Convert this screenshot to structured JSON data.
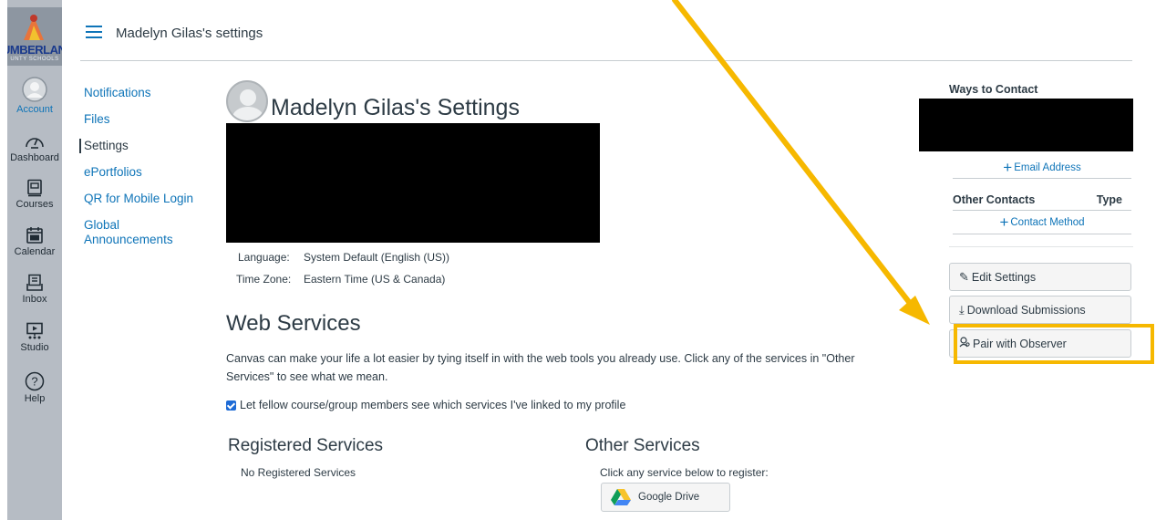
{
  "global_nav": {
    "logo": {
      "brand": "UMBERLAND",
      "sub": "UNTY SCHOOLS"
    },
    "items": [
      {
        "label": "Account",
        "icon": "account-icon"
      },
      {
        "label": "Dashboard",
        "icon": "dashboard-icon"
      },
      {
        "label": "Courses",
        "icon": "courses-icon"
      },
      {
        "label": "Calendar",
        "icon": "calendar-icon"
      },
      {
        "label": "Inbox",
        "icon": "inbox-icon"
      },
      {
        "label": "Studio",
        "icon": "studio-icon"
      },
      {
        "label": "Help",
        "icon": "help-icon"
      }
    ]
  },
  "header": {
    "breadcrumb": "Madelyn Gilas's settings"
  },
  "left_menu": {
    "items": [
      {
        "label": "Notifications",
        "active": false
      },
      {
        "label": "Files",
        "active": false
      },
      {
        "label": "Settings",
        "active": true
      },
      {
        "label": "ePortfolios",
        "active": false
      },
      {
        "label": "QR for Mobile Login",
        "active": false
      },
      {
        "label": "Global Announcements",
        "active": false
      }
    ]
  },
  "main": {
    "title": "Madelyn Gilas's Settings",
    "language_label": "Language:",
    "language_value": "System Default (English (US))",
    "timezone_label": "Time Zone:",
    "timezone_value": "Eastern Time (US & Canada)",
    "web_services_title": "Web Services",
    "web_services_desc": "Canvas can make your life a lot easier by tying itself in with the web tools you already use. Click any of the services in \"Other Services\" to see what we mean.",
    "checkbox_label": "Let fellow course/group members see which services I've linked to my profile",
    "checkbox_checked": true,
    "registered_title": "Registered Services",
    "registered_empty": "No Registered Services",
    "other_title": "Other Services",
    "other_hint": "Click any service below to register:",
    "google_drive_label": "Google Drive"
  },
  "sidebar": {
    "ways_to_contact": "Ways to Contact",
    "email_address_link": "Email Address",
    "other_contacts": "Other Contacts",
    "type_header": "Type",
    "contact_method_link": "Contact Method",
    "edit_settings": "Edit Settings",
    "download_submissions": "Download Submissions",
    "pair_with_observer": "Pair with Observer"
  },
  "colors": {
    "link": "#0e74b8",
    "nav_bg": "#b6bcc4",
    "highlight": "#f6b800"
  }
}
